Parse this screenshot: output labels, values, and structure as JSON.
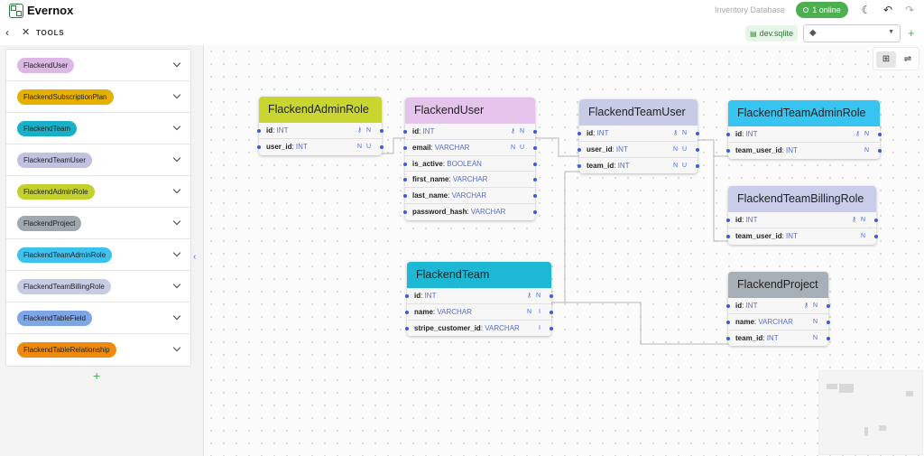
{
  "app": {
    "title": "Evernox",
    "database_name": "Inventory Database",
    "online_label": "1 online"
  },
  "topbar_icons": [
    "theme-toggle-icon",
    "undo-icon",
    "redo-icon"
  ],
  "toolbar": {
    "tools_label": "TOOLS",
    "environment": "dev.sqlite",
    "tag_placeholder": ""
  },
  "colors": {
    "accent": "#4caf50",
    "handle": "#3b5bdb",
    "type_text": "#5a6bc4"
  },
  "sidebar": {
    "tables": [
      {
        "label": "FlackendUser",
        "color": "#dcb8e4"
      },
      {
        "label": "FlackendSubscriptionPlan",
        "color": "#e6b000"
      },
      {
        "label": "FlackendTeam",
        "color": "#18b0c8"
      },
      {
        "label": "FlackendTeamUser",
        "color": "#c0c2e0"
      },
      {
        "label": "FlackendAdminRole",
        "color": "#c2d12c"
      },
      {
        "label": "FlackendProject",
        "color": "#9ea8ae"
      },
      {
        "label": "FlackendTeamAdminRole",
        "color": "#3cc2ee"
      },
      {
        "label": "FlackendTeamBillingRole",
        "color": "#c7cbe4"
      },
      {
        "label": "FlackendTableField",
        "color": "#7ea6e6"
      },
      {
        "label": "FlackendTableRelationship",
        "color": "#ee8a0c"
      }
    ]
  },
  "canvas": {
    "tables": [
      {
        "name": "FlackendAdminRole",
        "color": "#c9d630",
        "fields": [
          {
            "name": "id",
            "type": "INT",
            "icons": [
              "🔑",
              "N"
            ]
          },
          {
            "name": "user_id",
            "type": "INT",
            "icons": [
              "N",
              "U"
            ]
          }
        ]
      },
      {
        "name": "FlackendUser",
        "color": "#e4c4ea",
        "fields": [
          {
            "name": "id",
            "type": "INT",
            "icons": [
              "🔑",
              "N"
            ]
          },
          {
            "name": "email",
            "type": "VARCHAR",
            "icons": [
              "N",
              "U"
            ]
          },
          {
            "name": "is_active",
            "type": "BOOLEAN",
            "icons": []
          },
          {
            "name": "first_name",
            "type": "VARCHAR",
            "icons": []
          },
          {
            "name": "last_name",
            "type": "VARCHAR",
            "icons": []
          },
          {
            "name": "password_hash",
            "type": "VARCHAR",
            "icons": []
          }
        ]
      },
      {
        "name": "FlackendTeamUser",
        "color": "#c8cbe6",
        "fields": [
          {
            "name": "id",
            "type": "INT",
            "icons": [
              "🔑",
              "N"
            ]
          },
          {
            "name": "user_id",
            "type": "INT",
            "icons": [
              "N",
              "U"
            ]
          },
          {
            "name": "team_id",
            "type": "INT",
            "icons": [
              "N",
              "U"
            ]
          }
        ]
      },
      {
        "name": "FlackendTeamAdminRole",
        "color": "#38c4f0",
        "fields": [
          {
            "name": "id",
            "type": "INT",
            "icons": [
              "🔑",
              "N"
            ]
          },
          {
            "name": "team_user_id",
            "type": "INT",
            "icons": [
              "N"
            ]
          }
        ]
      },
      {
        "name": "FlackendTeamBillingRole",
        "color": "#c9cdea",
        "fields": [
          {
            "name": "id",
            "type": "INT",
            "icons": [
              "🔑",
              "N"
            ]
          },
          {
            "name": "team_user_id",
            "type": "INT",
            "icons": [
              "N"
            ]
          }
        ]
      },
      {
        "name": "FlackendTeam",
        "color": "#1cb8d4",
        "fields": [
          {
            "name": "id",
            "type": "INT",
            "icons": [
              "🔑",
              "N"
            ]
          },
          {
            "name": "name",
            "type": "VARCHAR",
            "icons": [
              "N",
              "I"
            ]
          },
          {
            "name": "stripe_customer_id",
            "type": "VARCHAR",
            "icons": [
              "I"
            ]
          }
        ]
      },
      {
        "name": "FlackendProject",
        "color": "#a6b0b6",
        "fields": [
          {
            "name": "id",
            "type": "INT",
            "icons": [
              "🔑",
              "N"
            ]
          },
          {
            "name": "name",
            "type": "VARCHAR",
            "icons": [
              "N"
            ]
          },
          {
            "name": "team_id",
            "type": "INT",
            "icons": [
              "N"
            ]
          }
        ]
      }
    ]
  }
}
